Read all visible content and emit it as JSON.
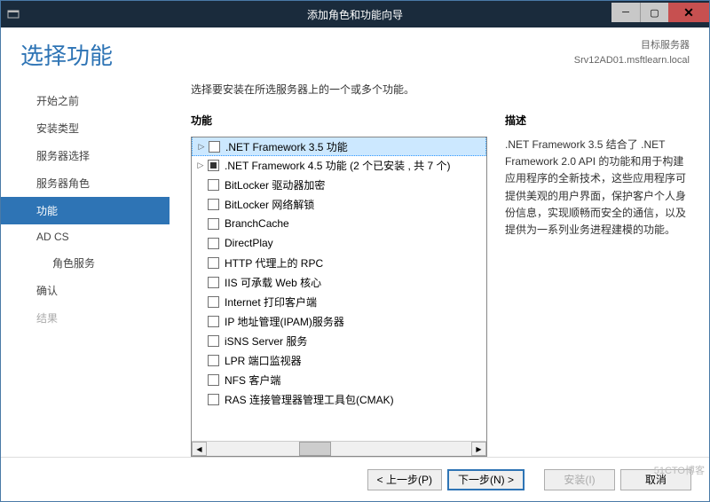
{
  "titlebar": {
    "title": "添加角色和功能向导"
  },
  "header": {
    "page_title": "选择功能",
    "target_label": "目标服务器",
    "target_server": "Srv12AD01.msftlearn.local"
  },
  "sidebar": {
    "items": [
      {
        "label": "开始之前",
        "state": "normal"
      },
      {
        "label": "安装类型",
        "state": "normal"
      },
      {
        "label": "服务器选择",
        "state": "normal"
      },
      {
        "label": "服务器角色",
        "state": "normal"
      },
      {
        "label": "功能",
        "state": "active"
      },
      {
        "label": "AD CS",
        "state": "normal"
      },
      {
        "label": "角色服务",
        "state": "indent"
      },
      {
        "label": "确认",
        "state": "normal"
      },
      {
        "label": "结果",
        "state": "disabled"
      }
    ]
  },
  "main": {
    "instruction": "选择要安装在所选服务器上的一个或多个功能。",
    "features_label": "功能",
    "desc_label": "描述",
    "description": ".NET Framework 3.5 结合了 .NET Framework 2.0 API 的功能和用于构建应用程序的全新技术，这些应用程序可提供美观的用户界面，保护客户个人身份信息，实现顺畅而安全的通信，以及提供为一系列业务进程建模的功能。",
    "tree": [
      {
        "expander": "▷",
        "checked": "",
        "label": ".NET Framework 3.5 功能",
        "selected": true
      },
      {
        "expander": "▷",
        "checked": "filled",
        "label": ".NET Framework 4.5 功能 (2 个已安装 , 共 7 个)"
      },
      {
        "expander": "",
        "checked": "",
        "label": "BitLocker 驱动器加密"
      },
      {
        "expander": "",
        "checked": "",
        "label": "BitLocker 网络解锁"
      },
      {
        "expander": "",
        "checked": "",
        "label": "BranchCache"
      },
      {
        "expander": "",
        "checked": "",
        "label": "DirectPlay"
      },
      {
        "expander": "",
        "checked": "",
        "label": "HTTP 代理上的 RPC"
      },
      {
        "expander": "",
        "checked": "",
        "label": "IIS 可承载 Web 核心"
      },
      {
        "expander": "",
        "checked": "",
        "label": "Internet 打印客户端"
      },
      {
        "expander": "",
        "checked": "",
        "label": "IP 地址管理(IPAM)服务器"
      },
      {
        "expander": "",
        "checked": "",
        "label": "iSNS Server 服务"
      },
      {
        "expander": "",
        "checked": "",
        "label": "LPR 端口监视器"
      },
      {
        "expander": "",
        "checked": "",
        "label": "NFS 客户端"
      },
      {
        "expander": "",
        "checked": "",
        "label": "RAS 连接管理器管理工具包(CMAK)"
      }
    ]
  },
  "footer": {
    "prev": "< 上一步(P)",
    "next": "下一步(N) >",
    "install": "安装(I)",
    "cancel": "取消"
  },
  "watermark": "51CTO博客"
}
